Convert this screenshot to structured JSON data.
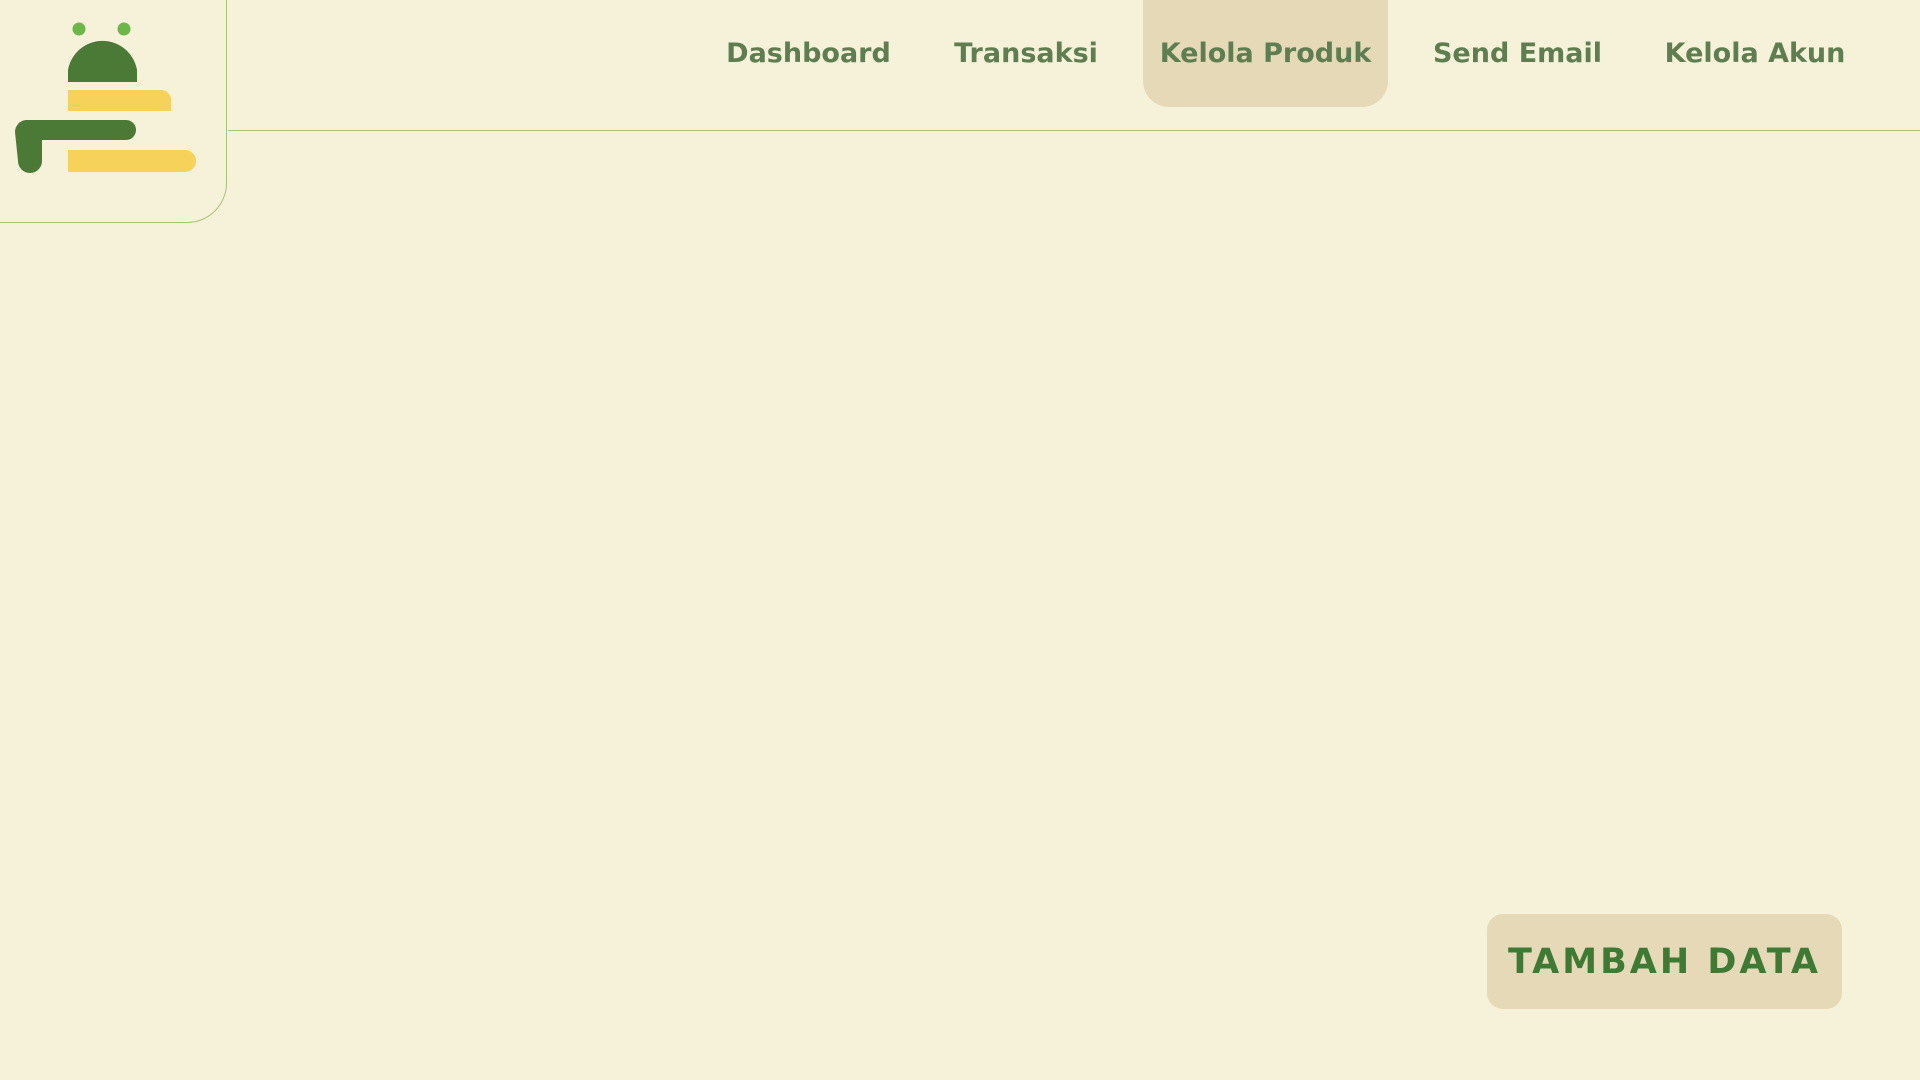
{
  "nav": {
    "items": [
      {
        "label": "Dashboard",
        "active": false
      },
      {
        "label": "Transaksi",
        "active": false
      },
      {
        "label": "Kelola Produk",
        "active": true
      },
      {
        "label": "Send Email",
        "active": false
      },
      {
        "label": "Kelola Akun",
        "active": false
      }
    ]
  },
  "actions": {
    "add_label": "TAMBAH DATA"
  },
  "colors": {
    "background": "#f6f1d9",
    "nav_active_bg": "#e6d9b8",
    "nav_text": "#5e7d50",
    "button_text": "#3f7a35",
    "logo_green": "#4a7a36",
    "logo_yellow": "#f6d25a",
    "accent_line": "#a8c27a"
  },
  "icons": {
    "logo": "stacked-bars-robot-logo"
  }
}
